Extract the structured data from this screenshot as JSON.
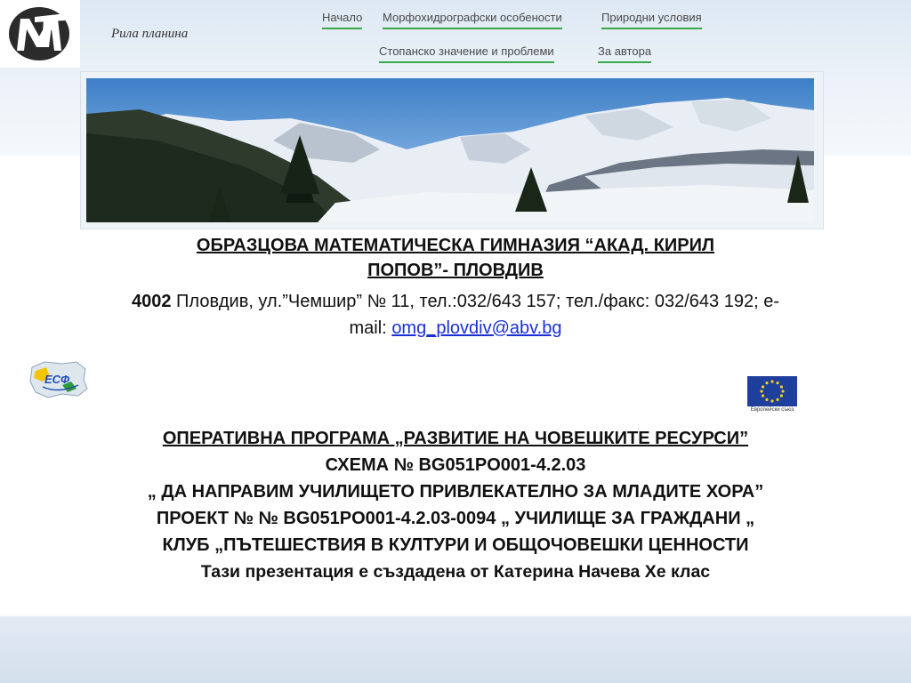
{
  "header": {
    "site_title": "Рила планина",
    "nav": [
      {
        "label": "Начало"
      },
      {
        "label": "Морфохидрографски особености"
      },
      {
        "label": "Природни условия"
      },
      {
        "label": "Стопанско значение и проблеми"
      },
      {
        "label": "За автора"
      }
    ]
  },
  "banner": {
    "alt": "Snowy Rila mountain panorama"
  },
  "school": {
    "name_line1": " ОБРАЗЦОВА МАТЕМАТИЧЕСКА ГИМНАЗИЯ “АКАД. КИРИЛ",
    "name_line2": "ПОПОВ”- ПЛОВДИВ",
    "postcode": "4002",
    "address_line1": " Пловдив, ул.”Чемшир” № 11, тел.:032/643 157; тел./факс: 032/643 192; е-",
    "mail_label": "mail: ",
    "email": "omg_plovdiv@abv.bg"
  },
  "logos": {
    "esf_text": "ЕСФ",
    "eu_caption": "Европейски съюз"
  },
  "program": {
    "line1": "ОПЕРАТИВНА  ПРОГРАМА „РАЗВИТИЕ  НА  ЧОВЕШКИТЕ  РЕСУРСИ”",
    "line2": "СХЕМА № BG051PO001-4.2.03",
    "line3": "„ ДА НАПРАВИМ УЧИЛИЩЕТО ПРИВЛЕКАТЕЛНО ЗА МЛАДИТЕ ХОРА”",
    "line4": "ПРОЕКТ № № BG051PO001-4.2.03-0094  „ УЧИЛИЩЕ ЗА ГРАЖДАНИ „",
    "line5": "КЛУБ  „ПЪТЕШЕСТВИЯ  В  КУЛТУРИ  И  ОБЩОЧОВЕШКИ  ЦЕННОСТИ",
    "line6": "Тази презентация е създадена от  Катерина Начева Хе клас"
  }
}
